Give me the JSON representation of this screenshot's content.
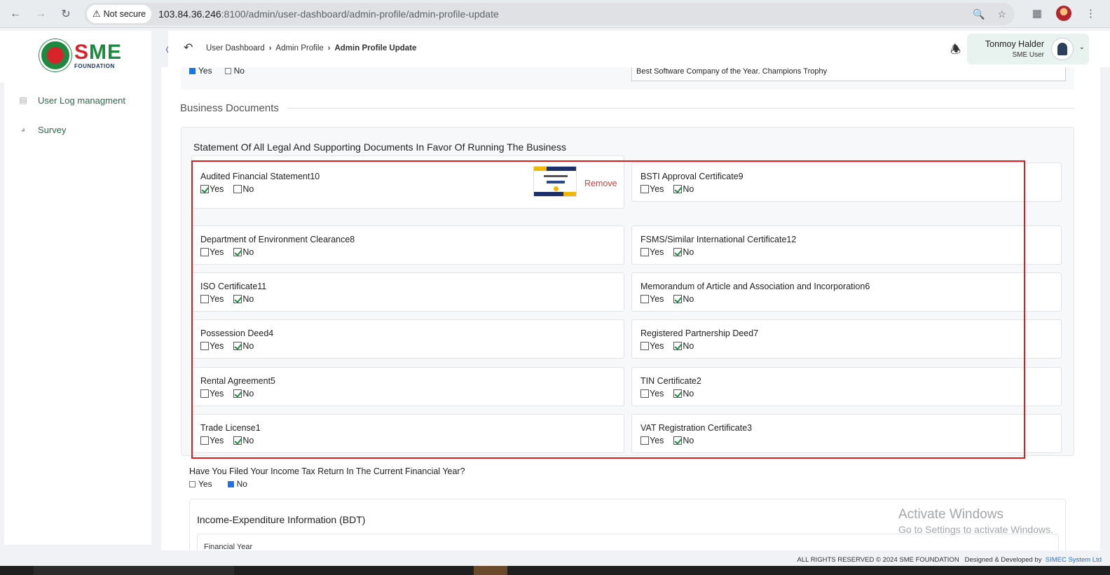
{
  "browser": {
    "security_label": "Not secure",
    "url_host": "103.84.36.246",
    "url_rest": ":8100/admin/user-dashboard/admin-profile/admin-profile-update"
  },
  "brand": {
    "logo_s": "S",
    "logo_m": "M",
    "logo_e": "E",
    "foundation": "FOUNDATION"
  },
  "sidebar": {
    "items": [
      {
        "label": "User Log managment",
        "icon": "log-icon"
      },
      {
        "label": "Survey",
        "icon": "pie-chart-icon"
      }
    ]
  },
  "header": {
    "breadcrumb": [
      "User Dashboard",
      "Admin Profile",
      "Admin Profile Update"
    ],
    "user_name": "Tonmoy Halder",
    "user_role": "SME User"
  },
  "previous": {
    "yes_label": "Yes",
    "no_label": "No",
    "yes_checked": true,
    "award_value": "Best Software Company of the Year.  Champions Trophy"
  },
  "section_title": "Business Documents",
  "documents": {
    "title": "Statement Of All Legal And Supporting Documents In Favor Of Running The Business",
    "remove_label": "Remove",
    "yes_label": "Yes",
    "no_label": "No",
    "items": [
      {
        "label": "Audited Financial Statement10",
        "answer": "yes",
        "has_attachment": true
      },
      {
        "label": "BSTI Approval Certificate9",
        "answer": "no"
      },
      {
        "label": "Department of Environment Clearance8",
        "answer": "no"
      },
      {
        "label": "FSMS/Similar International Certificate12",
        "answer": "no"
      },
      {
        "label": "ISO Certificate11",
        "answer": "no"
      },
      {
        "label": "Memorandum of Article and Association and Incorporation6",
        "answer": "no"
      },
      {
        "label": "Possession Deed4",
        "answer": "no"
      },
      {
        "label": "Registered Partnership Deed7",
        "answer": "no"
      },
      {
        "label": "Rental Agreement5",
        "answer": "no"
      },
      {
        "label": "TIN Certificate2",
        "answer": "no"
      },
      {
        "label": "Trade License1",
        "answer": "no"
      },
      {
        "label": "VAT Registration Certificate3",
        "answer": "no"
      }
    ]
  },
  "tax": {
    "question": "Have You Filed Your Income Tax Return In The Current Financial Year?",
    "yes_label": "Yes",
    "no_label": "No",
    "answer": "no"
  },
  "income": {
    "title": "Income-Expenditure Information (BDT)",
    "financial_year_label": "Financial Year"
  },
  "watermark": {
    "line1": "Activate Windows",
    "line2": "Go to Settings to activate Windows."
  },
  "footer": {
    "rights": "ALL RIGHTS RESERVED © 2024 SME FOUNDATION",
    "designed_by": "Designed & Developed by",
    "company": "SIMEC System Ltd"
  }
}
